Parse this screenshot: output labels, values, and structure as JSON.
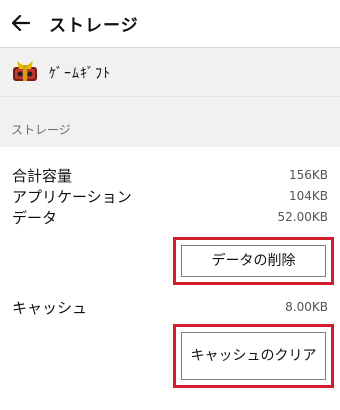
{
  "header": {
    "title": "ストレージ"
  },
  "app": {
    "name": "ｹﾞｰﾑｷﾞﾌﾄ"
  },
  "section": {
    "title": "ストレージ"
  },
  "storage": {
    "total_label": "合計容量",
    "total_value": "156KB",
    "app_label": "アプリケーション",
    "app_value": "104KB",
    "data_label": "データ",
    "data_value": "52.00KB"
  },
  "buttons": {
    "delete_data": "データの削除",
    "clear_cache": "キャッシュのクリア"
  },
  "cache": {
    "label": "キャッシュ",
    "value": "8.00KB"
  },
  "colors": {
    "accent": "#d01e2a"
  }
}
